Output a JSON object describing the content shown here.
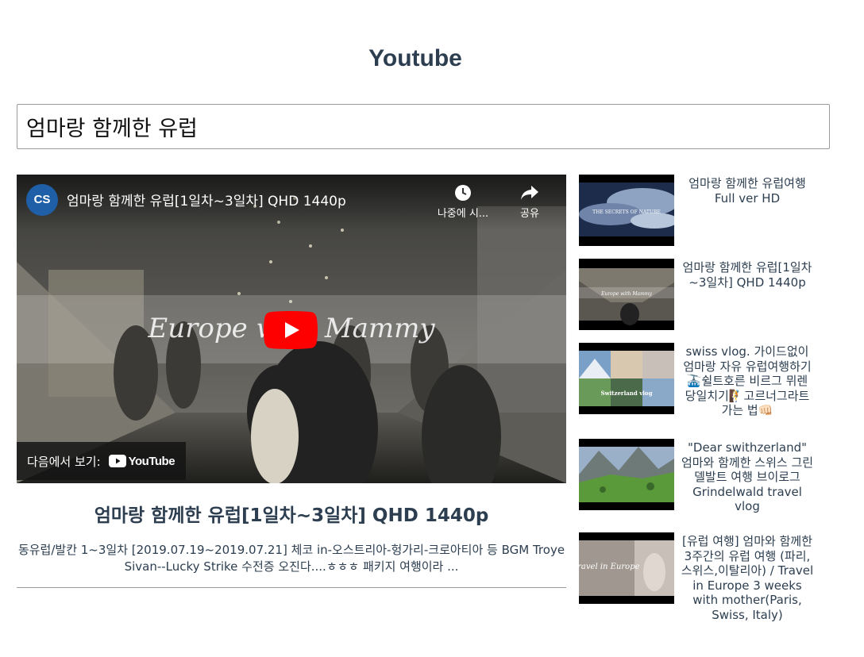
{
  "app": {
    "title": "Youtube"
  },
  "search": {
    "value": "엄마랑 함께한 유럽"
  },
  "player": {
    "channel_initials": "CS",
    "title": "엄마랑 함께한 유럽[1일차~3일차] QHD 1440p",
    "watch_later_label": "나중에 시...",
    "share_label": "공유",
    "watch_on_label": "다음에서 보기:",
    "yt_logo_text": "YouTube",
    "overlay_text": "Europe with Mammy"
  },
  "video": {
    "title": "엄마랑 함께한 유럽[1일차~3일차] QHD 1440p",
    "description": "동유럽/발칸 1~3일차 [2019.07.19~2019.07.21] 체코 in-오스트리아-헝가리-크로아티아 등 BGM Troye Sivan--Lucky Strike 수전증 오진다....ㅎㅎㅎ 패키지 여행이라 ..."
  },
  "related": [
    {
      "title": "엄마랑 함께한 유럽여행 Full ver HD",
      "thumb_text": "THE SECRETS OF NATURE"
    },
    {
      "title": "엄마랑 함께한 유럽[1일차~3일차] QHD 1440p",
      "thumb_text": "Europe with Mammy"
    },
    {
      "title": "swiss vlog. 가이드없이 엄마랑 자유 유럽여행하기 🚠쉴트호른 비르그 뮈렌 당일치기🧗고르너그라트 가는 법👊🏻",
      "thumb_text": "Switzerland vlog"
    },
    {
      "title": "\"Dear swithzerland\" 엄마와 함께한 스위스 그린델발트 여행 브이로그 Grindelwald travel vlog",
      "thumb_text": ""
    },
    {
      "title": "[유럽 여행] 엄마와 함께한 3주간의 유럽 여행 (파리,스위스,이탈리아) / Travel in Europe 3 weeks with mother(Paris, Swiss, Italy)",
      "thumb_text": "Travel in Europe"
    }
  ],
  "colors": {
    "heading": "#2c3e50",
    "play_red": "#ff0000",
    "avatar_blue": "#1f5fa8"
  },
  "icons": [
    "clock-icon",
    "share-icon",
    "play-icon",
    "youtube-logo-icon"
  ]
}
